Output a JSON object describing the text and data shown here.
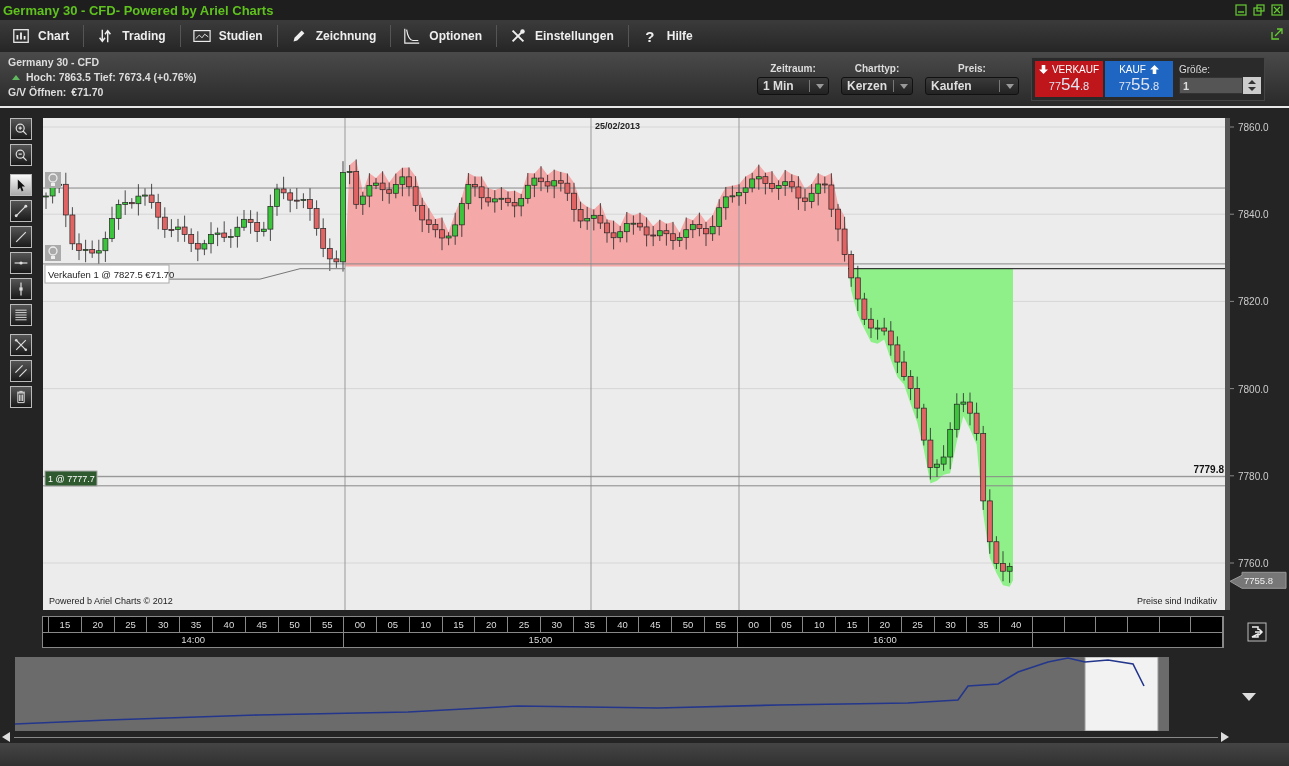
{
  "window": {
    "title": "Germany 30 - CFD- Powered by Ariel Charts"
  },
  "menu": [
    {
      "label": "Chart"
    },
    {
      "label": "Trading"
    },
    {
      "label": "Studien"
    },
    {
      "label": "Zeichnung"
    },
    {
      "label": "Optionen"
    },
    {
      "label": "Einstellungen"
    },
    {
      "label": "Hilfe",
      "glyph": "?"
    }
  ],
  "instrument": {
    "name": "Germany 30 - CFD",
    "high_low": "Hoch: 7863.5 Tief: 7673.4 (+0.76%)",
    "pnl_label": "G/V Öffnen:",
    "pnl_value": "€71.70"
  },
  "selectors": [
    {
      "label": "Zeitraum:",
      "value": "1 Min"
    },
    {
      "label": "Charttyp:",
      "value": "Kerzen"
    },
    {
      "label": "Preis:",
      "value": "Kaufen"
    }
  ],
  "trade": {
    "sell": {
      "label": "VERKAUF",
      "price_prefix": "77",
      "price_main": "54",
      "price_suffix": ".8"
    },
    "buy": {
      "label": "KAUF",
      "price_prefix": "77",
      "price_main": "55",
      "price_suffix": ".8"
    },
    "size_label": "Größe:",
    "size_value": "1"
  },
  "tool_groups": [
    [
      {
        "selected": false
      },
      {
        "selected": false
      }
    ],
    [
      {
        "selected": true
      },
      {
        "selected": false
      },
      {
        "selected": false
      },
      {
        "selected": false
      },
      {
        "selected": false
      },
      {
        "selected": false
      }
    ],
    [
      {
        "selected": false
      },
      {
        "selected": false
      },
      {
        "selected": false
      }
    ]
  ],
  "chart": {
    "date_label": "25/02/2013",
    "y_axis_labels": [
      "7860.0",
      "7840.0",
      "7820.0",
      "7800.0",
      "7780.0",
      "7760.0"
    ],
    "order_label": "Verkaufen 1 @ 7827.5 €71.70",
    "position_label": "1 @ 7777.7",
    "level_label": "7779.8",
    "current_price": "7755.8",
    "credit": "Powered b Ariel Charts © 2012",
    "disclaimer": "Preise sind Indikativ"
  },
  "time_axis": [
    {
      "hour": "14:00",
      "minutes": [
        "15",
        "20",
        "25",
        "30",
        "35",
        "40",
        "45",
        "50",
        "55"
      ]
    },
    {
      "hour": "15:00",
      "minutes": [
        "00",
        "05",
        "10",
        "15",
        "20",
        "25",
        "30",
        "35",
        "40",
        "45",
        "50",
        "55"
      ]
    },
    {
      "hour": "16:00",
      "minutes": [
        "00",
        "05",
        "10",
        "15",
        "20",
        "25",
        "30",
        "35",
        "40"
      ]
    }
  ]
}
